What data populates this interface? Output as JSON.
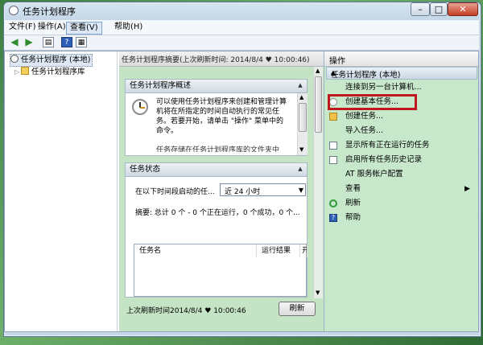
{
  "window": {
    "title": "任务计划程序",
    "controls": {
      "minimize": "–",
      "maximize": "□",
      "close": "✕"
    }
  },
  "menu": {
    "items": [
      "文件(F)",
      "操作(A)",
      "查看(V)",
      "帮助(H)"
    ],
    "active_index": 2
  },
  "toolbar": {
    "icons": [
      "back-arrow-icon",
      "forward-arrow-icon",
      "show-hide-tree-icon",
      "help-icon",
      "properties-icon"
    ]
  },
  "tree": {
    "items": [
      {
        "label": "任务计划程序 (本地)",
        "icon": "clock-icon",
        "expander": ""
      },
      {
        "label": "任务计划程序库",
        "icon": "folder-icon",
        "expander": "▷"
      }
    ]
  },
  "center": {
    "header": "任务计划程序摘要(上次刷新时间: 2014/8/4 ♥ 10:00:46)",
    "overview": {
      "title": "任务计划程序概述",
      "lines": [
        "可以使用任务计划程序来创建和管理计算",
        "机将在所指定的时间自动执行的常见任",
        "务。若要开始，请单击 \"操作\" 菜单中的",
        "命令。",
        "",
        "任务存储在任务计划程序库的文件夹中"
      ]
    },
    "status": {
      "title": "任务状态",
      "filter_label": "在以下时间段启动的任...",
      "filter_value": "近 24 小时",
      "summary": "摘要: 总计 0 个 - 0 个正在运行，0 个成功，0 个...",
      "columns": [
        "任务名",
        "运行结果",
        "开"
      ]
    },
    "footer": {
      "last_refresh": "上次刷新时间2014/8/4 ♥ 10:00:46",
      "refresh_button": "刷新"
    }
  },
  "actions": {
    "title": "操作",
    "section": "任务计划程序 (本地)",
    "items": [
      {
        "label": "连接到另一台计算机...",
        "icon": ""
      },
      {
        "label": "创建基本任务...",
        "icon": "create-basic-task-icon",
        "highlighted": true
      },
      {
        "label": "创建任务...",
        "icon": "create-task-icon"
      },
      {
        "label": "导入任务...",
        "icon": ""
      },
      {
        "label": "显示所有正在运行的任务",
        "icon": "running-tasks-icon"
      },
      {
        "label": "启用所有任务历史记录",
        "icon": "history-icon"
      },
      {
        "label": "AT 服务帐户配置",
        "icon": ""
      },
      {
        "label": "查看",
        "icon": "",
        "submenu": "▶"
      },
      {
        "label": "刷新",
        "icon": "refresh-icon"
      },
      {
        "label": "帮助",
        "icon": "help-icon"
      }
    ]
  },
  "colors": {
    "center_bg": "#c5e4c5",
    "actions_bg": "#c8e8cc",
    "highlight_box": "#c0161e"
  }
}
